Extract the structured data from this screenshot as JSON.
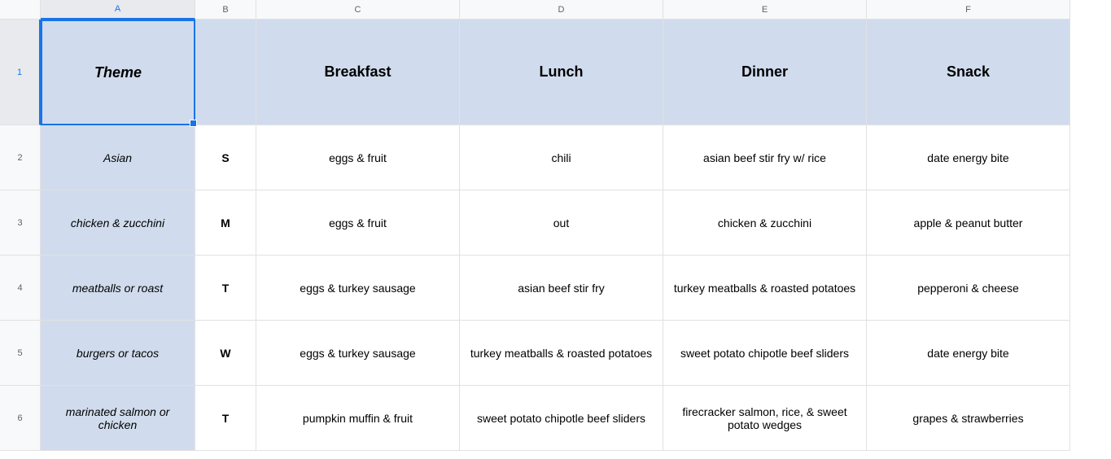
{
  "columns": [
    "A",
    "B",
    "C",
    "D",
    "E",
    "F"
  ],
  "rowNumbers": [
    "1",
    "2",
    "3",
    "4",
    "5",
    "6"
  ],
  "selectedCell": "A1",
  "headerRow": {
    "theme": "Theme",
    "day": "",
    "breakfast": "Breakfast",
    "lunch": "Lunch",
    "dinner": "Dinner",
    "snack": "Snack"
  },
  "rows": [
    {
      "theme": "Asian",
      "day": "S",
      "breakfast": "eggs & fruit",
      "lunch": "chili",
      "dinner": "asian beef stir fry w/ rice",
      "snack": "date energy bite"
    },
    {
      "theme": "chicken & zucchini",
      "day": "M",
      "breakfast": "eggs & fruit",
      "lunch": "out",
      "dinner": "chicken & zucchini",
      "snack": "apple & peanut butter"
    },
    {
      "theme": "meatballs or roast",
      "day": "T",
      "breakfast": "eggs & turkey sausage",
      "lunch": "asian beef stir fry",
      "dinner": "turkey meatballs & roasted potatoes",
      "snack": "pepperoni & cheese"
    },
    {
      "theme": "burgers or tacos",
      "day": "W",
      "breakfast": "eggs & turkey sausage",
      "lunch": "turkey meatballs & roasted potatoes",
      "dinner": "sweet potato chipotle beef sliders",
      "snack": "date energy bite"
    },
    {
      "theme": "marinated salmon or chicken",
      "day": "T",
      "breakfast": "pumpkin muffin & fruit",
      "lunch": "sweet potato chipotle beef sliders",
      "dinner": "firecracker salmon, rice, & sweet potato wedges",
      "snack": "grapes & strawberries"
    }
  ]
}
